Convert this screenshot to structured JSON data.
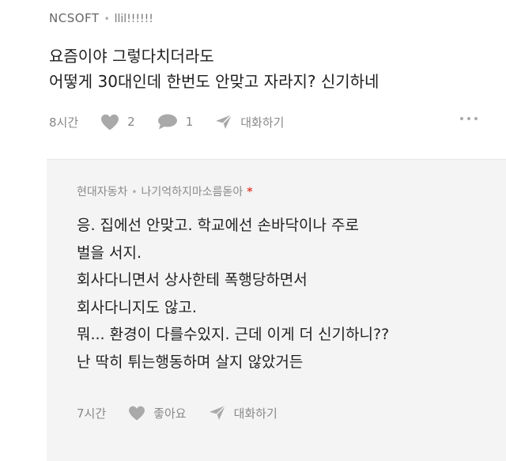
{
  "post": {
    "company": "NCSOFT",
    "nickname": "llil!!!!!!",
    "lines": [
      "요즘이야 그렇다치더라도",
      "어떻게 30대인데 한번도 안맞고 자라지? 신기하네"
    ],
    "time": "8시간",
    "likes": "2",
    "comments": "1",
    "chat_label": "대화하기"
  },
  "reply": {
    "company": "현대자동차",
    "nickname": "나기억하지마소름돋아",
    "marker": "*",
    "lines": [
      "응. 집에선 안맞고. 학교에선 손바닥이나 주로",
      "벌을 서지.",
      "회사다니면서 상사한테 폭행당하면서",
      "회사다니지도 않고.",
      "뭐... 환경이 다를수있지. 근데 이게 더 신기하니??",
      "난 딱히 튀는행동하며 살지 않았거든"
    ],
    "time": "7시간",
    "like_label": "좋아요",
    "chat_label": "대화하기"
  },
  "icons": {
    "heart": "heart-icon",
    "comment": "comment-bubble-icon",
    "send": "send-paper-plane-icon",
    "more": "more-dots-icon"
  },
  "colors": {
    "background": "#ffffff",
    "reply_background": "#f4f4f5",
    "muted_text": "#888888",
    "icon": "#a9a9a9",
    "marker": "#e0463a"
  }
}
